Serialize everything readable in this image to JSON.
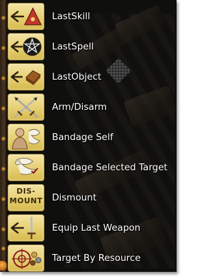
{
  "macros": [
    {
      "label": "LastSkill",
      "icon": "arrow-triangle-icon"
    },
    {
      "label": "LastSpell",
      "icon": "arrow-pentagram-icon"
    },
    {
      "label": "LastObject",
      "icon": "arrow-object-icon"
    },
    {
      "label": "Arm/Disarm",
      "icon": "crossed-swords-icon"
    },
    {
      "label": "Bandage Self",
      "icon": "bandage-self-icon"
    },
    {
      "label": "Bandage Selected Target",
      "icon": "bandage-target-icon"
    },
    {
      "label": "Dismount",
      "icon": "dismount-icon",
      "icon_text": "DIS-\nMOUNT"
    },
    {
      "label": "Equip Last Weapon",
      "icon": "arrow-weapon-icon"
    },
    {
      "label": "Target By Resource",
      "icon": "target-resource-icon"
    }
  ],
  "colors": {
    "panel_bg": "#0f0f0e",
    "icon_gold": "#e6cf72",
    "label_text": "#ffffff",
    "accent_orange": "#c98a2e"
  }
}
